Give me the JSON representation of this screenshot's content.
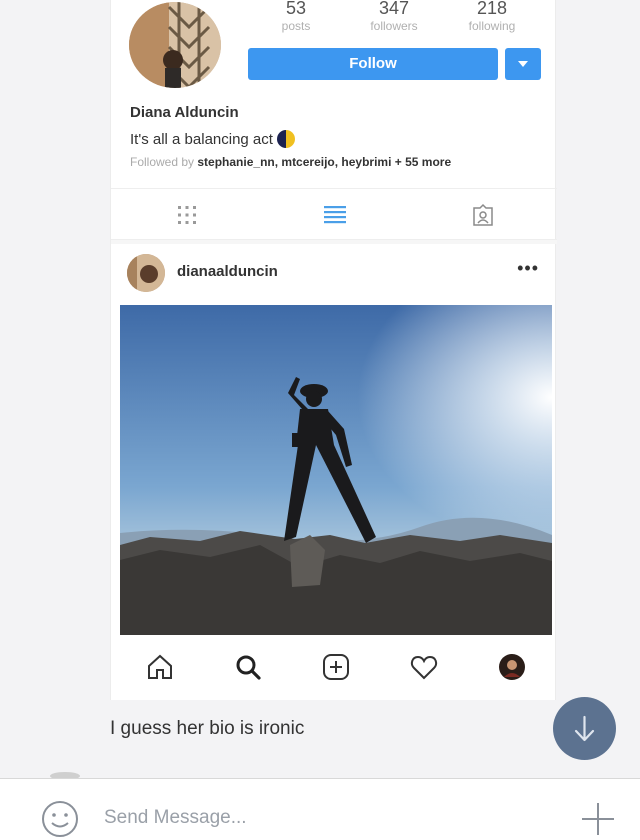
{
  "profile": {
    "stats": [
      {
        "value": "53",
        "label": "posts"
      },
      {
        "value": "347",
        "label": "followers"
      },
      {
        "value": "218",
        "label": "following"
      }
    ],
    "follow_label": "Follow",
    "name": "Diana Alduncin",
    "bio": "It's all a balancing act",
    "followed_prefix": "Followed by",
    "followed_names": "stephanie_nn, mtcereijo, heybrimi",
    "followed_more": "+ 55 more"
  },
  "post": {
    "username": "dianaalduncin",
    "more_icon": "ellipsis-icon"
  },
  "tabs": [
    "grid-icon",
    "list-icon",
    "tagged-icon"
  ],
  "bottom_nav": [
    "home-icon",
    "search-icon",
    "add-icon",
    "heart-icon",
    "profile-avatar"
  ],
  "chat": {
    "message": "I guess her bio is ironic",
    "composer_placeholder": "Send Message..."
  },
  "colors": {
    "follow_blue": "#3d97f0",
    "scroll_button": "#5c7290"
  }
}
